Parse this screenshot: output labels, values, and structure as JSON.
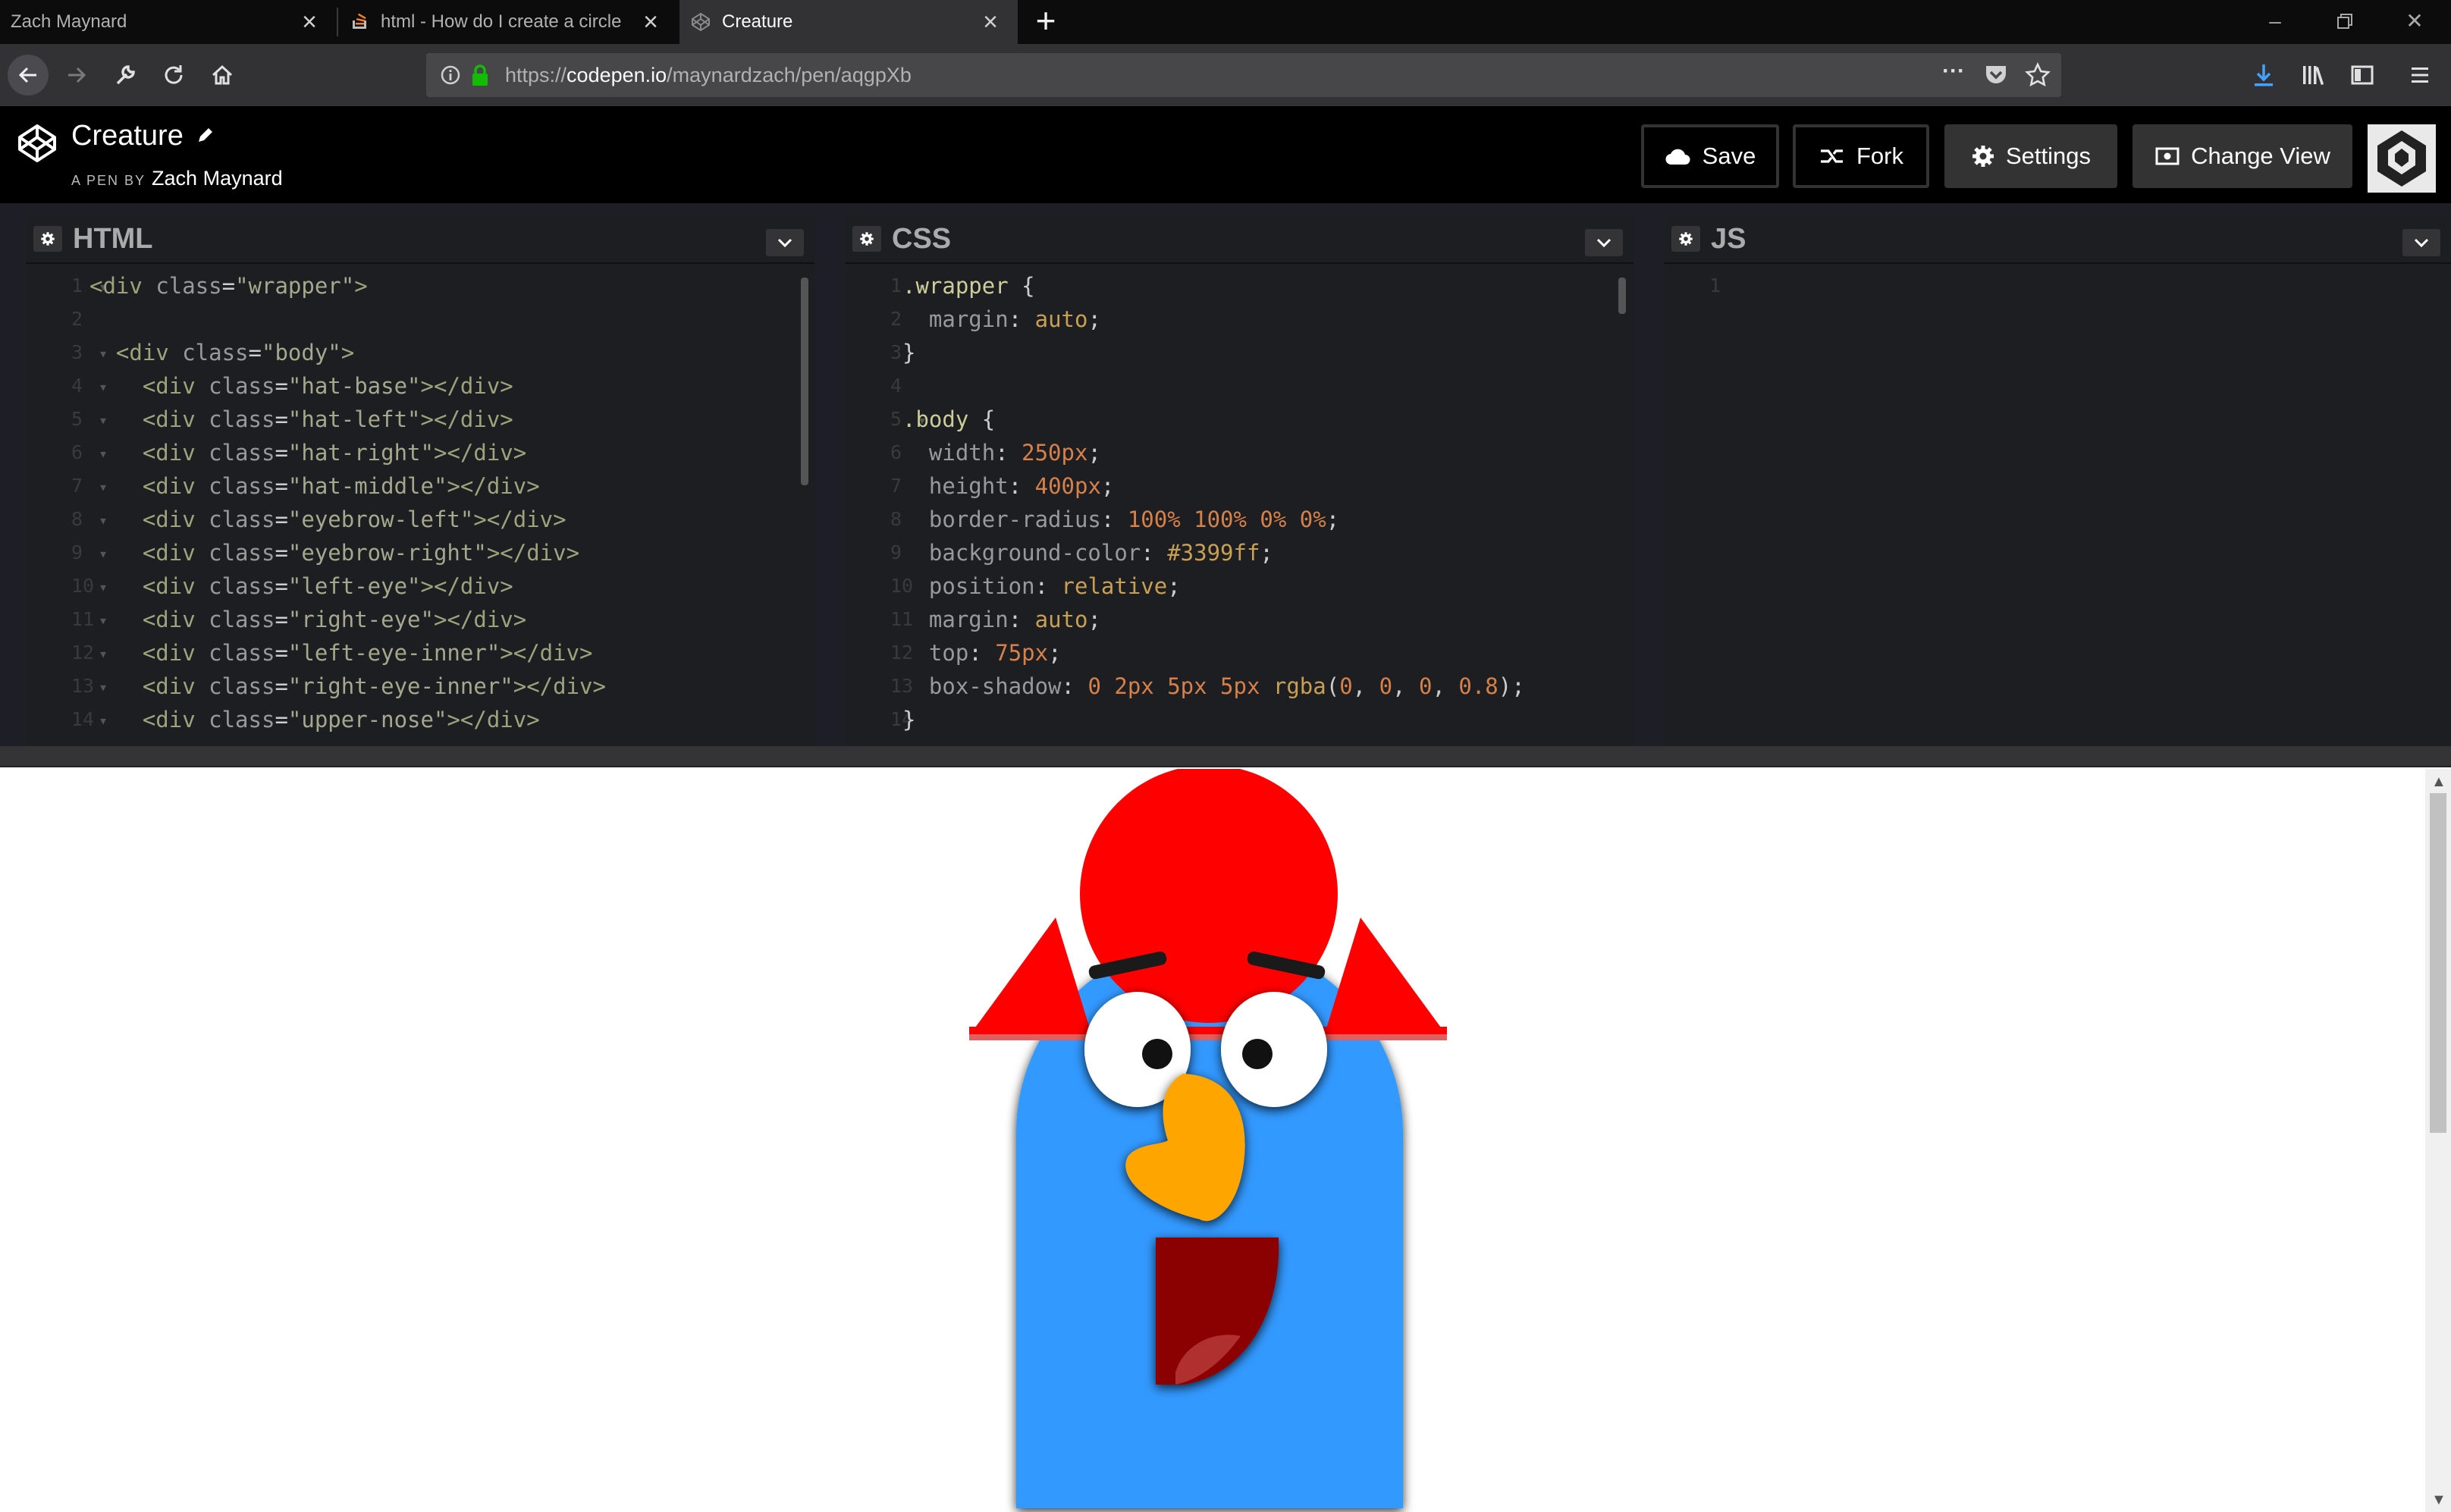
{
  "browser": {
    "tabs": [
      {
        "title": "Zach Maynard"
      },
      {
        "title": "html - How do I create a circle"
      },
      {
        "title": "Creature"
      }
    ],
    "url_prefix": "https://",
    "url_host": "codepen.io",
    "url_path": "/maynardzach/pen/aqgpXb"
  },
  "pen": {
    "title": "Creature",
    "byline_prefix": "A PEN BY",
    "author": "Zach Maynard",
    "buttons": {
      "save": "Save",
      "fork": "Fork",
      "settings": "Settings",
      "change_view": "Change View"
    }
  },
  "editors": {
    "html": {
      "title": "HTML",
      "lines": [
        {
          "n": "1",
          "fold": true,
          "segs": [
            [
              "t-tag",
              "<div "
            ],
            [
              "t-attr",
              "class"
            ],
            [
              "t-pun",
              "="
            ],
            [
              "t-str",
              "\"wrapper\""
            ],
            [
              "t-tag",
              ">"
            ]
          ]
        },
        {
          "n": "2",
          "fold": false,
          "segs": []
        },
        {
          "n": "3",
          "fold": true,
          "segs": [
            [
              "t-tag",
              "  <div "
            ],
            [
              "t-attr",
              "class"
            ],
            [
              "t-pun",
              "="
            ],
            [
              "t-str",
              "\"body\""
            ],
            [
              "t-tag",
              ">"
            ]
          ]
        },
        {
          "n": "4",
          "fold": true,
          "segs": [
            [
              "t-tag",
              "    <div "
            ],
            [
              "t-attr",
              "class"
            ],
            [
              "t-pun",
              "="
            ],
            [
              "t-str",
              "\"hat-base\""
            ],
            [
              "t-tag",
              "></div>"
            ]
          ]
        },
        {
          "n": "5",
          "fold": true,
          "segs": [
            [
              "t-tag",
              "    <div "
            ],
            [
              "t-attr",
              "class"
            ],
            [
              "t-pun",
              "="
            ],
            [
              "t-str",
              "\"hat-left\""
            ],
            [
              "t-tag",
              "></div>"
            ]
          ]
        },
        {
          "n": "6",
          "fold": true,
          "segs": [
            [
              "t-tag",
              "    <div "
            ],
            [
              "t-attr",
              "class"
            ],
            [
              "t-pun",
              "="
            ],
            [
              "t-str",
              "\"hat-right\""
            ],
            [
              "t-tag",
              "></div>"
            ]
          ]
        },
        {
          "n": "7",
          "fold": true,
          "segs": [
            [
              "t-tag",
              "    <div "
            ],
            [
              "t-attr",
              "class"
            ],
            [
              "t-pun",
              "="
            ],
            [
              "t-str",
              "\"hat-middle\""
            ],
            [
              "t-tag",
              "></div>"
            ]
          ]
        },
        {
          "n": "8",
          "fold": true,
          "segs": [
            [
              "t-tag",
              "    <div "
            ],
            [
              "t-attr",
              "class"
            ],
            [
              "t-pun",
              "="
            ],
            [
              "t-str",
              "\"eyebrow-left\""
            ],
            [
              "t-tag",
              "></div>"
            ]
          ]
        },
        {
          "n": "9",
          "fold": true,
          "segs": [
            [
              "t-tag",
              "    <div "
            ],
            [
              "t-attr",
              "class"
            ],
            [
              "t-pun",
              "="
            ],
            [
              "t-str",
              "\"eyebrow-right\""
            ],
            [
              "t-tag",
              "></div>"
            ]
          ]
        },
        {
          "n": "10",
          "fold": true,
          "segs": [
            [
              "t-tag",
              "    <div "
            ],
            [
              "t-attr",
              "class"
            ],
            [
              "t-pun",
              "="
            ],
            [
              "t-str",
              "\"left-eye\""
            ],
            [
              "t-tag",
              "></div>"
            ]
          ]
        },
        {
          "n": "11",
          "fold": true,
          "segs": [
            [
              "t-tag",
              "    <div "
            ],
            [
              "t-attr",
              "class"
            ],
            [
              "t-pun",
              "="
            ],
            [
              "t-str",
              "\"right-eye\""
            ],
            [
              "t-tag",
              "></div>"
            ]
          ]
        },
        {
          "n": "12",
          "fold": true,
          "segs": [
            [
              "t-tag",
              "    <div "
            ],
            [
              "t-attr",
              "class"
            ],
            [
              "t-pun",
              "="
            ],
            [
              "t-str",
              "\"left-eye-inner\""
            ],
            [
              "t-tag",
              "></div>"
            ]
          ]
        },
        {
          "n": "13",
          "fold": true,
          "segs": [
            [
              "t-tag",
              "    <div "
            ],
            [
              "t-attr",
              "class"
            ],
            [
              "t-pun",
              "="
            ],
            [
              "t-str",
              "\"right-eye-inner\""
            ],
            [
              "t-tag",
              "></div>"
            ]
          ]
        },
        {
          "n": "14",
          "fold": true,
          "segs": [
            [
              "t-tag",
              "    <div "
            ],
            [
              "t-attr",
              "class"
            ],
            [
              "t-pun",
              "="
            ],
            [
              "t-str",
              "\"upper-nose\""
            ],
            [
              "t-tag",
              "></div>"
            ]
          ]
        }
      ]
    },
    "css": {
      "title": "CSS",
      "lines": [
        {
          "n": "1",
          "fold": true,
          "segs": [
            [
              "t-sel",
              ".wrapper "
            ],
            [
              "t-pun",
              "{"
            ]
          ]
        },
        {
          "n": "2",
          "fold": false,
          "segs": [
            [
              "t-prop",
              "  margin"
            ],
            [
              "t-pun",
              ": "
            ],
            [
              "t-val",
              "auto"
            ],
            [
              "t-pun",
              ";"
            ]
          ]
        },
        {
          "n": "3",
          "fold": false,
          "segs": [
            [
              "t-pun",
              "}"
            ]
          ]
        },
        {
          "n": "4",
          "fold": false,
          "segs": []
        },
        {
          "n": "5",
          "fold": true,
          "segs": [
            [
              "t-sel",
              ".body "
            ],
            [
              "t-pun",
              "{"
            ]
          ]
        },
        {
          "n": "6",
          "fold": false,
          "segs": [
            [
              "t-prop",
              "  width"
            ],
            [
              "t-pun",
              ": "
            ],
            [
              "t-num",
              "250px"
            ],
            [
              "t-pun",
              ";"
            ]
          ]
        },
        {
          "n": "7",
          "fold": false,
          "segs": [
            [
              "t-prop",
              "  height"
            ],
            [
              "t-pun",
              ": "
            ],
            [
              "t-num",
              "400px"
            ],
            [
              "t-pun",
              ";"
            ]
          ]
        },
        {
          "n": "8",
          "fold": false,
          "segs": [
            [
              "t-prop",
              "  border-radius"
            ],
            [
              "t-pun",
              ": "
            ],
            [
              "t-num",
              "100% 100% 0% 0%"
            ],
            [
              "t-pun",
              ";"
            ]
          ]
        },
        {
          "n": "9",
          "fold": false,
          "segs": [
            [
              "t-prop",
              "  background-color"
            ],
            [
              "t-pun",
              ": "
            ],
            [
              "t-val",
              "#3399ff"
            ],
            [
              "t-pun",
              ";"
            ]
          ]
        },
        {
          "n": "10",
          "fold": false,
          "segs": [
            [
              "t-prop",
              "  position"
            ],
            [
              "t-pun",
              ": "
            ],
            [
              "t-val",
              "relative"
            ],
            [
              "t-pun",
              ";"
            ]
          ]
        },
        {
          "n": "11",
          "fold": false,
          "segs": [
            [
              "t-prop",
              "  margin"
            ],
            [
              "t-pun",
              ": "
            ],
            [
              "t-val",
              "auto"
            ],
            [
              "t-pun",
              ";"
            ]
          ]
        },
        {
          "n": "12",
          "fold": false,
          "segs": [
            [
              "t-prop",
              "  top"
            ],
            [
              "t-pun",
              ": "
            ],
            [
              "t-num",
              "75px"
            ],
            [
              "t-pun",
              ";"
            ]
          ]
        },
        {
          "n": "13",
          "fold": false,
          "segs": [
            [
              "t-prop",
              "  box-shadow"
            ],
            [
              "t-pun",
              ": "
            ],
            [
              "t-num",
              "0 2px 5px 5px "
            ],
            [
              "t-val",
              "rgba"
            ],
            [
              "t-pun",
              "("
            ],
            [
              "t-num",
              "0"
            ],
            [
              "t-pun",
              ", "
            ],
            [
              "t-num",
              "0"
            ],
            [
              "t-pun",
              ", "
            ],
            [
              "t-num",
              "0"
            ],
            [
              "t-pun",
              ", "
            ],
            [
              "t-num",
              "0.8"
            ],
            [
              "t-pun",
              ");"
            ]
          ]
        },
        {
          "n": "14",
          "fold": false,
          "segs": [
            [
              "t-pun",
              "}"
            ]
          ]
        }
      ]
    },
    "js": {
      "title": "JS",
      "lines": [
        {
          "n": "1",
          "fold": false,
          "segs": []
        }
      ]
    }
  },
  "colors": {
    "creature_body": "#3399ff",
    "hat": "#ff0000",
    "beak": "#ffa500",
    "mouth": "#8b0000",
    "tongue": "#b03030"
  }
}
